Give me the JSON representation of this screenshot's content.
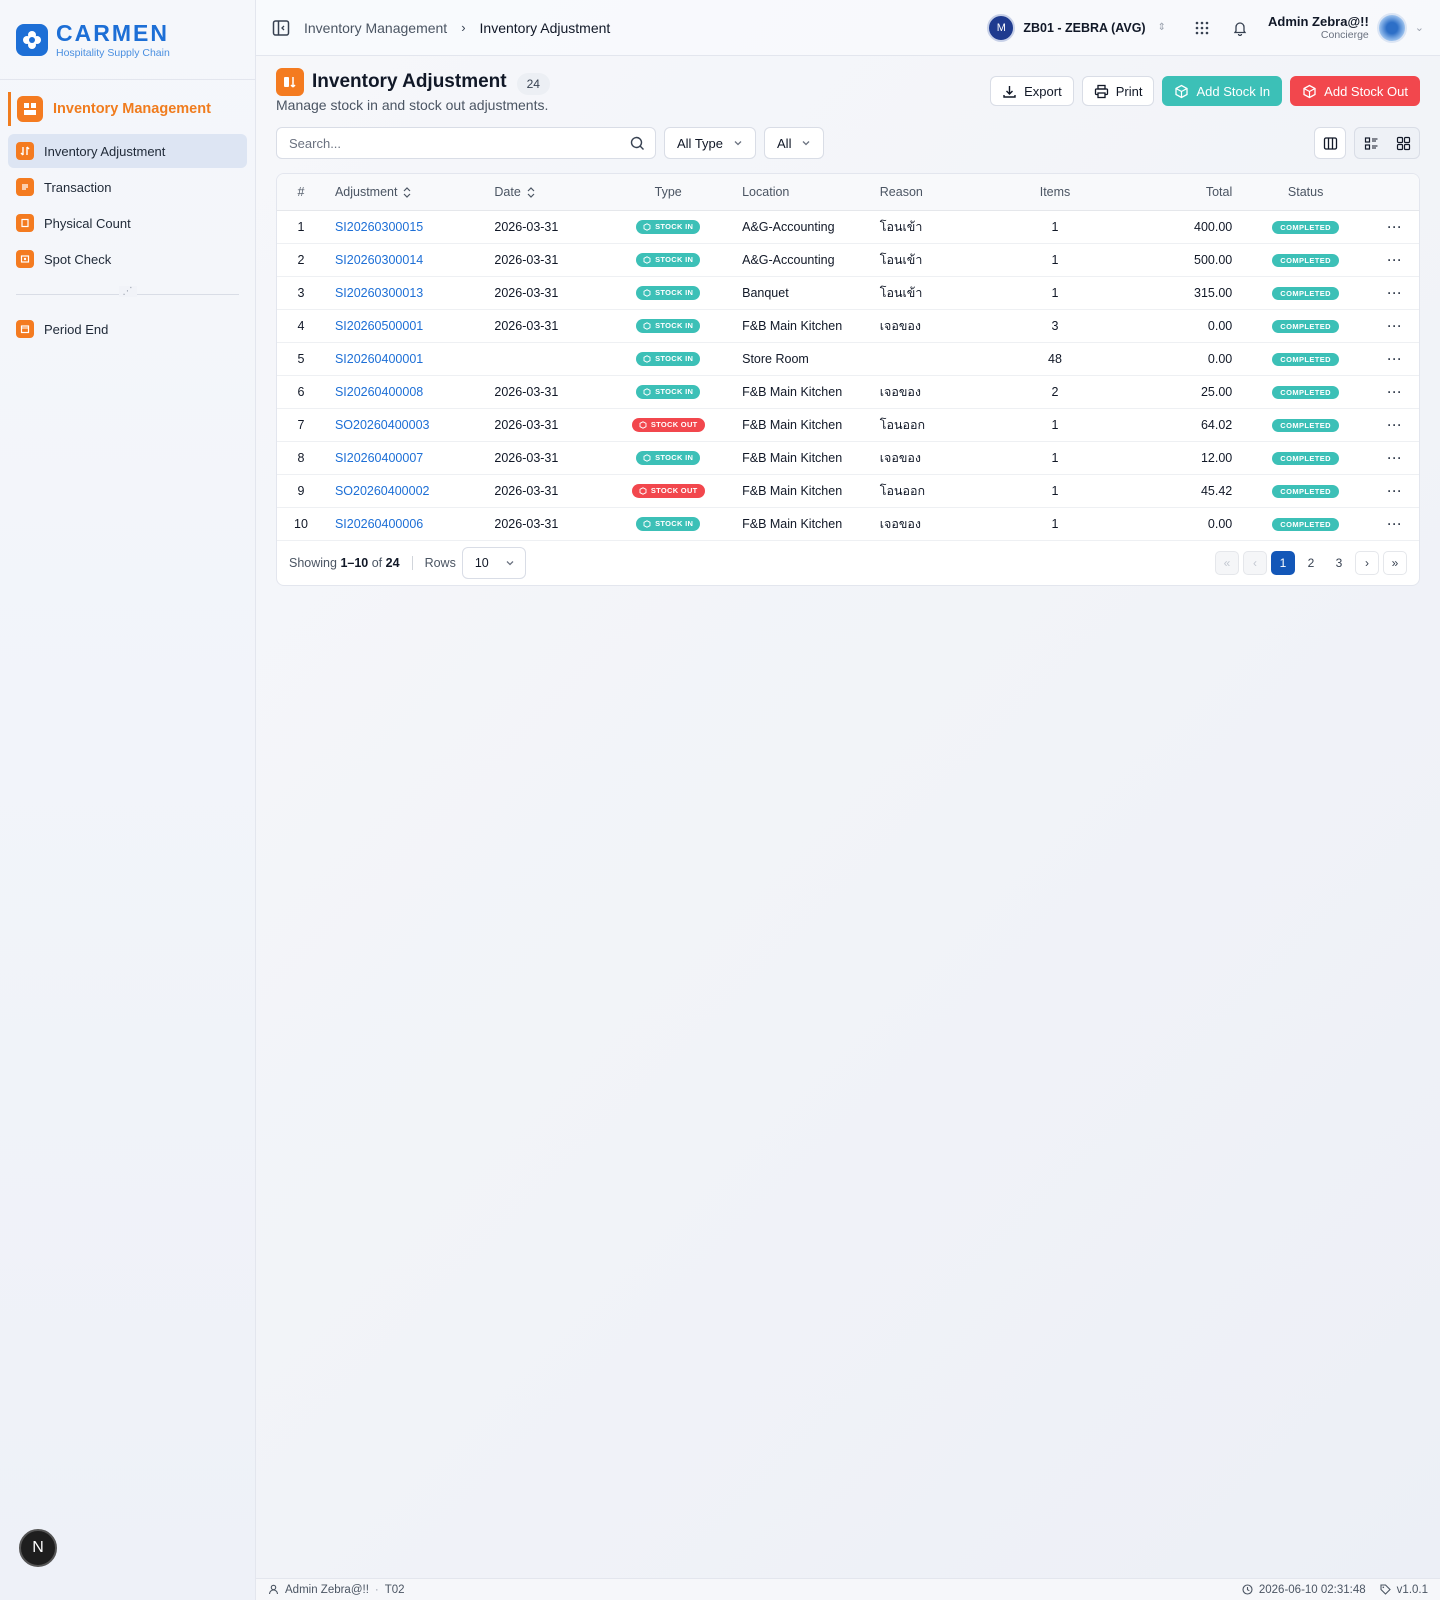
{
  "brand": {
    "name": "CARMEN",
    "subtitle": "Hospitality Supply Chain"
  },
  "sidebar": {
    "module_label": "Inventory Management",
    "items": [
      {
        "label": "Inventory Adjustment"
      },
      {
        "label": "Transaction"
      },
      {
        "label": "Physical Count"
      },
      {
        "label": "Spot Check"
      }
    ],
    "bottom_items": [
      {
        "label": "Period End"
      }
    ],
    "badge": "N"
  },
  "topbar": {
    "breadcrumb": [
      "Inventory Management",
      "Inventory Adjustment"
    ],
    "business_unit": "ZB01 - ZEBRA (AVG)",
    "user_name": "Admin Zebra@!!",
    "user_role": "Concierge"
  },
  "page": {
    "title": "Inventory Adjustment",
    "count": "24",
    "subtitle": "Manage stock in and stock out adjustments.",
    "buttons": {
      "export": "Export",
      "print": "Print",
      "add_stock_in": "Add Stock In",
      "add_stock_out": "Add Stock Out"
    }
  },
  "filters": {
    "search_placeholder": "Search...",
    "type_value": "All Type",
    "status_value": "All"
  },
  "table": {
    "headers": {
      "num": "#",
      "adjustment": "Adjustment",
      "date": "Date",
      "type": "Type",
      "location": "Location",
      "reason": "Reason",
      "items": "Items",
      "total": "Total",
      "status": "Status"
    },
    "rows": [
      {
        "num": "1",
        "adjustment": "SI20260300015",
        "date": "2026-03-31",
        "type": "STOCK IN",
        "type_kind": "in",
        "location": "A&G-Accounting",
        "reason": "โอนเข้า",
        "items": "1",
        "total": "400.00",
        "status": "COMPLETED"
      },
      {
        "num": "2",
        "adjustment": "SI20260300014",
        "date": "2026-03-31",
        "type": "STOCK IN",
        "type_kind": "in",
        "location": "A&G-Accounting",
        "reason": "โอนเข้า",
        "items": "1",
        "total": "500.00",
        "status": "COMPLETED"
      },
      {
        "num": "3",
        "adjustment": "SI20260300013",
        "date": "2026-03-31",
        "type": "STOCK IN",
        "type_kind": "in",
        "location": "Banquet",
        "reason": "โอนเข้า",
        "items": "1",
        "total": "315.00",
        "status": "COMPLETED"
      },
      {
        "num": "4",
        "adjustment": "SI20260500001",
        "date": "2026-03-31",
        "type": "STOCK IN",
        "type_kind": "in",
        "location": "F&B Main Kitchen",
        "reason": "เจอของ",
        "items": "3",
        "total": "0.00",
        "status": "COMPLETED"
      },
      {
        "num": "5",
        "adjustment": "SI20260400001",
        "date": "",
        "type": "STOCK IN",
        "type_kind": "in",
        "location": "Store Room",
        "reason": "",
        "items": "48",
        "total": "0.00",
        "status": "COMPLETED"
      },
      {
        "num": "6",
        "adjustment": "SI20260400008",
        "date": "2026-03-31",
        "type": "STOCK IN",
        "type_kind": "in",
        "location": "F&B Main Kitchen",
        "reason": "เจอของ",
        "items": "2",
        "total": "25.00",
        "status": "COMPLETED"
      },
      {
        "num": "7",
        "adjustment": "SO20260400003",
        "date": "2026-03-31",
        "type": "STOCK OUT",
        "type_kind": "out",
        "location": "F&B Main Kitchen",
        "reason": "โอนออก",
        "items": "1",
        "total": "64.02",
        "status": "COMPLETED"
      },
      {
        "num": "8",
        "adjustment": "SI20260400007",
        "date": "2026-03-31",
        "type": "STOCK IN",
        "type_kind": "in",
        "location": "F&B Main Kitchen",
        "reason": "เจอของ",
        "items": "1",
        "total": "12.00",
        "status": "COMPLETED"
      },
      {
        "num": "9",
        "adjustment": "SO20260400002",
        "date": "2026-03-31",
        "type": "STOCK OUT",
        "type_kind": "out",
        "location": "F&B Main Kitchen",
        "reason": "โอนออก",
        "items": "1",
        "total": "45.42",
        "status": "COMPLETED"
      },
      {
        "num": "10",
        "adjustment": "SI20260400006",
        "date": "2026-03-31",
        "type": "STOCK IN",
        "type_kind": "in",
        "location": "F&B Main Kitchen",
        "reason": "เจอของ",
        "items": "1",
        "total": "0.00",
        "status": "COMPLETED"
      }
    ]
  },
  "pagination": {
    "showing_label": "Showing",
    "range": "1–10",
    "of_label": "of",
    "total": "24",
    "rows_label": "Rows",
    "rows_value": "10",
    "pages": [
      "1",
      "2",
      "3"
    ],
    "current_page": "1"
  },
  "statusbar": {
    "user": "Admin Zebra@!!",
    "code": "T02",
    "datetime": "2026-06-10 02:31:48",
    "version": "v1.0.1"
  },
  "colors": {
    "brand": "#1d6fd6",
    "accent_orange": "#f47b20",
    "stock_in": "#3cc0b7",
    "stock_out": "#f2474d",
    "page_active": "#1357b8"
  }
}
